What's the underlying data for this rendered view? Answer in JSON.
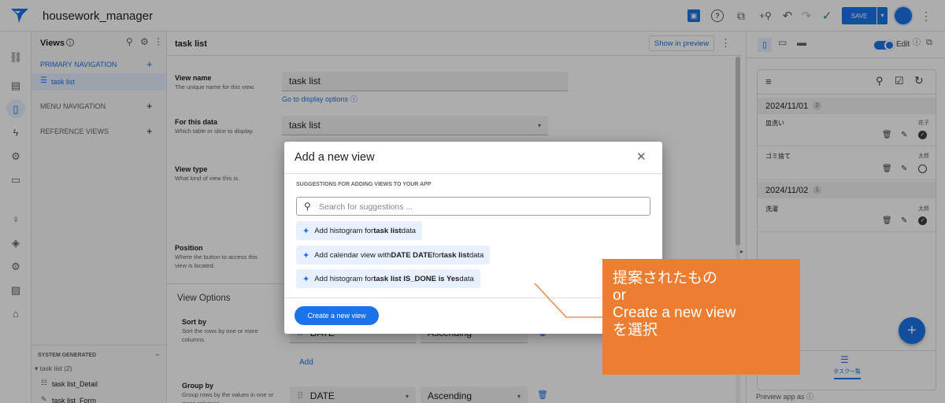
{
  "topbar": {
    "app_name": "housework_manager",
    "save_label": "SAVE"
  },
  "views_panel": {
    "title": "Views",
    "primary_nav": "PRIMARY NAVIGATION",
    "primary_items": [
      "task list"
    ],
    "menu_nav": "MENU NAVIGATION",
    "reference_views": "REFERENCE VIEWS",
    "system_generated": "SYSTEM GENERATED",
    "group_label": "task list (2)",
    "system_items": [
      "task list_Detail",
      "task list_Form"
    ]
  },
  "editor": {
    "title": "task list",
    "show_in_preview": "Show in preview",
    "view_name_label": "View name",
    "view_name_desc": "The unique name for this view.",
    "view_name_value": "task list",
    "go_display": "Go to display options",
    "for_data_label": "For this data",
    "for_data_desc": "Which table or slice to display.",
    "for_data_value": "task list",
    "view_type_label": "View type",
    "view_type_desc": "What kind of view this is.",
    "position_label": "Position",
    "position_desc": "Where the button to access this view is located.",
    "view_options": "View Options",
    "sort_label": "Sort by",
    "sort_desc": "Sort the rows by one or more columns.",
    "sort_col": "DATE",
    "sort_order": "Ascending",
    "add_label": "Add",
    "group_label": "Group by",
    "group_desc": "Group rows by the values in one or more columns.",
    "group_col": "DATE",
    "group_order": "Ascending"
  },
  "modal": {
    "title": "Add a new view",
    "section": "SUGGESTIONS FOR ADDING VIEWS TO YOUR APP",
    "search_placeholder": "Search for suggestions ...",
    "s1_a": "Add histogram for ",
    "s1_b": "task list",
    "s1_c": " data",
    "s2_a": "Add calendar view with ",
    "s2_b": "DATE DATE",
    "s2_c": " for ",
    "s2_d": "task list",
    "s2_e": " data",
    "s3_a": "Add histogram for ",
    "s3_b": "task list IS_DONE is Yes",
    "s3_c": " data",
    "create_button": "Create a new view"
  },
  "callout": {
    "line1": "提案されたもの",
    "line2": "or",
    "line3": "Create a new view",
    "line4": "を選択"
  },
  "preview": {
    "edit_label": "Edit",
    "groups": [
      {
        "date": "2024/11/01",
        "count": "2",
        "items": [
          {
            "task": "皿洗い",
            "who": "花子",
            "done": true
          },
          {
            "task": "ゴミ捨て",
            "who": "太郎",
            "done": false
          }
        ]
      },
      {
        "date": "2024/11/02",
        "count": "1",
        "items": [
          {
            "task": "洗濯",
            "who": "太郎",
            "done": true
          }
        ]
      }
    ],
    "bottom_tab": "タスク一覧",
    "preview_as": "Preview app as"
  },
  "colors": {
    "accent": "#1a73e8",
    "callout": "#ed7d31",
    "chip": "#e8f0fe"
  }
}
